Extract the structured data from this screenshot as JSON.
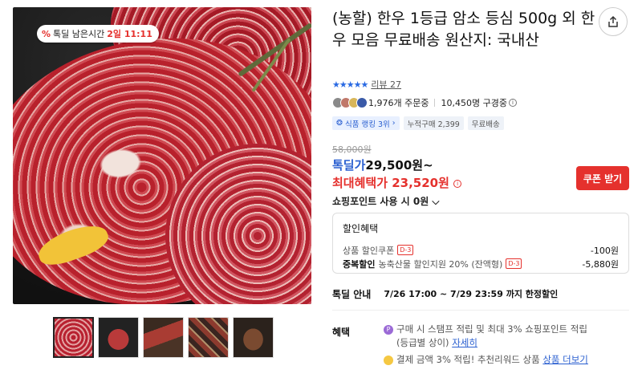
{
  "image": {
    "badge_icon": "%",
    "badge_label": "톡딜 남은시간",
    "badge_time": "2일 11:11"
  },
  "thumbnails": [
    "thumb-1",
    "thumb-2",
    "thumb-3",
    "thumb-4",
    "thumb-5"
  ],
  "product": {
    "title": "(농할) 한우 1등급 암소 등심 500g 외 한우 모음 무료배송 원산지: 국내산",
    "stars": "★★★★★",
    "review_label": "리뷰 27",
    "orders": "1,976개 주문중",
    "subscribers": "10,450명 구경중"
  },
  "tags": {
    "rank": "식품 랭킹 3위",
    "cumulative": "누적구매 2,399",
    "shipping": "무료배송"
  },
  "price": {
    "original": "58,000원",
    "deal_prefix": "톡딜가",
    "deal_amount": "29,500원~",
    "max_benefit": "최대혜택가 23,520원",
    "coupon_button": "쿠폰 받기",
    "points": "쇼핑포인트 사용 시 0원"
  },
  "discount": {
    "title": "할인혜택",
    "line1_label": "상품 할인쿠폰",
    "line1_tag": "D-3",
    "line1_amount": "-100원",
    "line2_bold": "중복할인",
    "line2_label": "농축산물 할인지원 20% (잔액형)",
    "line2_tag": "D-3",
    "line2_amount": "-5,880원"
  },
  "deal_info": {
    "label": "톡딜 안내",
    "value": "7/26 17:00 ~ 7/29 23:59 까지 한정할인"
  },
  "benefits": {
    "label": "혜택",
    "item1_text": "구매 시 스탬프 적립 및 최대 3% 쇼핑포인트 적립",
    "item1_sub": "(등급별 상이)",
    "item1_link": "자세히",
    "item2_text": "결제 금액 3% 적립! 추천리워드 상품",
    "item2_link": "상품 더보기"
  },
  "colors": {
    "accent_red": "#e5312d",
    "accent_blue": "#2a5fd0"
  }
}
